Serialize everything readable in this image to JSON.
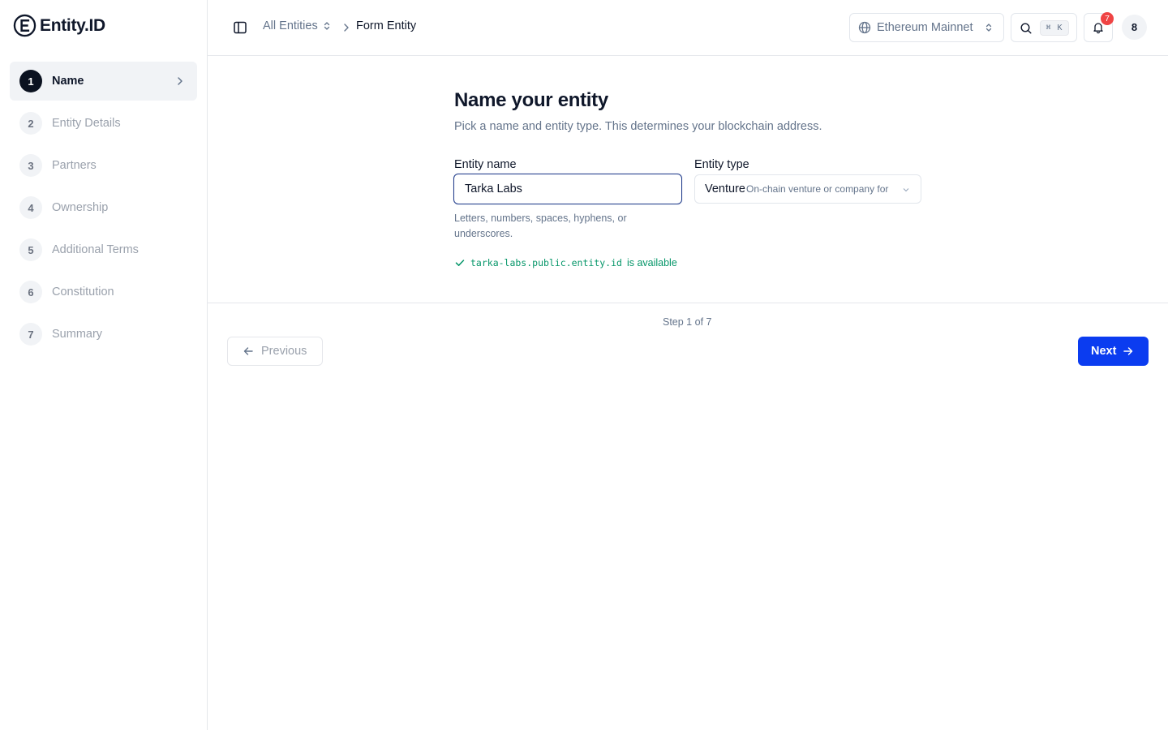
{
  "brand": {
    "name": "Entity.ID"
  },
  "steps": [
    {
      "num": "1",
      "label": "Name",
      "active": true
    },
    {
      "num": "2",
      "label": "Entity Details"
    },
    {
      "num": "3",
      "label": "Partners"
    },
    {
      "num": "4",
      "label": "Ownership"
    },
    {
      "num": "5",
      "label": "Additional Terms"
    },
    {
      "num": "6",
      "label": "Constitution"
    },
    {
      "num": "7",
      "label": "Summary"
    }
  ],
  "header": {
    "breadcrumb_all": "All Entities",
    "breadcrumb_current": "Form Entity",
    "network": "Ethereum Mainnet",
    "search_shortcut": "⌘ K",
    "notifications_count": "7",
    "avatar_initial": "8"
  },
  "form": {
    "title": "Name your entity",
    "subtitle": "Pick a name and entity type. This determines your blockchain address.",
    "name_label": "Entity name",
    "name_value": "Tarka Labs",
    "type_label": "Entity type",
    "type_value": "Venture",
    "type_description": "On-chain venture or company for",
    "hint": "Letters, numbers, spaces, hyphens, or underscores.",
    "availability_id": "tarka-labs.public.entity.id",
    "availability_text": "is available"
  },
  "footer": {
    "step_count": "Step 1 of 7",
    "previous_label": "Previous",
    "next_label": "Next"
  },
  "colors": {
    "accent": "#0b3cf0",
    "success": "#059669",
    "badge": "#ef4444",
    "active_step": "#0b1220"
  }
}
